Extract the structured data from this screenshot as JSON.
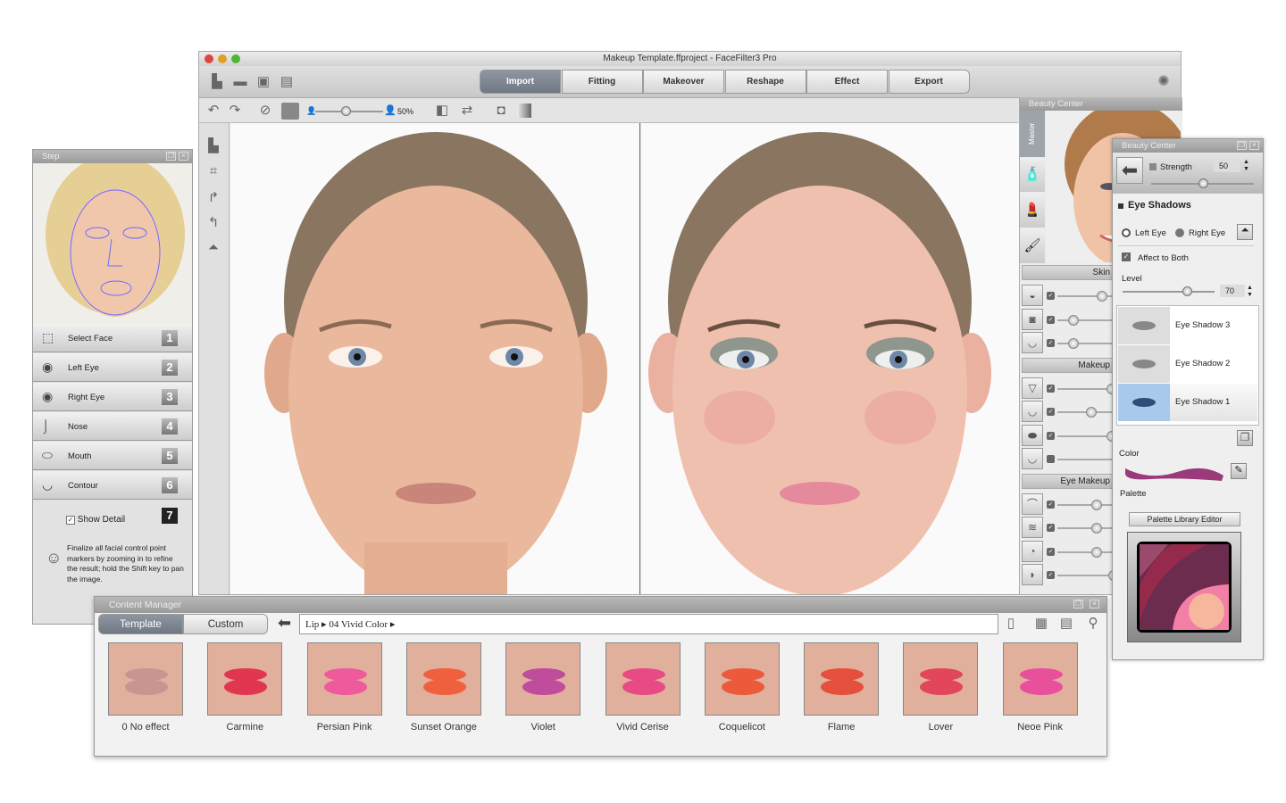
{
  "main_window": {
    "title": "Makeup Template.ffproject - FaceFilter3 Pro",
    "tabs": [
      {
        "label": "Import",
        "active": true
      },
      {
        "label": "Fitting"
      },
      {
        "label": "Makeover"
      },
      {
        "label": "Reshape"
      },
      {
        "label": "Effect"
      },
      {
        "label": "Export"
      }
    ],
    "zoom_level": "50%",
    "zoom_fraction": 0.45
  },
  "beauty_center_docked": {
    "title": "Beauty Center",
    "side_tab": "Master",
    "sections": [
      {
        "label": "Skin",
        "sliders": [
          0.75,
          0.2,
          0.2
        ]
      },
      {
        "label": "Makeup",
        "sliders": [
          0.95,
          0.55,
          0.95,
          null
        ]
      },
      {
        "label": "Eye Makeup",
        "sliders": [
          0.65,
          0.65,
          0.65,
          0.98
        ]
      }
    ]
  },
  "step_panel": {
    "title": "Step",
    "steps": [
      {
        "label": "Select Face",
        "num": "1",
        "icon": "select-face-icon"
      },
      {
        "label": "Left Eye",
        "num": "2",
        "icon": "eye-icon"
      },
      {
        "label": "Right Eye",
        "num": "3",
        "icon": "eye-icon"
      },
      {
        "label": "Nose",
        "num": "4",
        "icon": "nose-icon"
      },
      {
        "label": "Mouth",
        "num": "5",
        "icon": "mouth-icon"
      },
      {
        "label": "Contour",
        "num": "6",
        "icon": "contour-icon"
      }
    ],
    "show_detail": {
      "label": "Show Detail",
      "num": "7",
      "checked": true
    },
    "hint": "Finalize all facial control point markers by zooming in to refine the result; hold the Shift key to pan the image."
  },
  "beauty_center_floating": {
    "title": "Beauty Center",
    "strength": {
      "label": "Strength",
      "value": "50",
      "fraction": 0.5
    },
    "section": "Eye Shadows",
    "left_eye": "Left Eye",
    "right_eye": "Right Eye",
    "affect_both": {
      "label": "Affect to Both",
      "checked": true
    },
    "level": {
      "label": "Level",
      "value": "70",
      "fraction": 0.7
    },
    "shadows": [
      {
        "label": "Eye Shadow 3"
      },
      {
        "label": "Eye Shadow 2"
      },
      {
        "label": "Eye Shadow 1",
        "selected": true
      }
    ],
    "color_label": "Color",
    "color": "#9b3a7a",
    "palette_label": "Palette",
    "palette_button": "Palette Library Editor",
    "palette_colors": [
      "#9c4a6c",
      "#962a4c",
      "#6b2c4d",
      "#f27fa6",
      "#f7b79c"
    ]
  },
  "content_manager": {
    "title": "Content Manager",
    "tabs": [
      {
        "label": "Template",
        "active": true
      },
      {
        "label": "Custom"
      }
    ],
    "path": [
      "Lip",
      "04 Vivid Color"
    ],
    "items": [
      {
        "label": "0 No effect",
        "color": "#c99590"
      },
      {
        "label": "Carmine",
        "color": "#e2354f"
      },
      {
        "label": "Persian Pink",
        "color": "#ee5a9c"
      },
      {
        "label": "Sunset Orange",
        "color": "#f0603e"
      },
      {
        "label": "Violet",
        "color": "#c04c9c"
      },
      {
        "label": "Vivid Cerise",
        "color": "#e84a86"
      },
      {
        "label": "Coquelicot",
        "color": "#ec5a3c"
      },
      {
        "label": "Flame",
        "color": "#e4503c"
      },
      {
        "label": "Lover",
        "color": "#e2465a"
      },
      {
        "label": "Neoe Pink",
        "color": "#e8509c"
      }
    ]
  }
}
